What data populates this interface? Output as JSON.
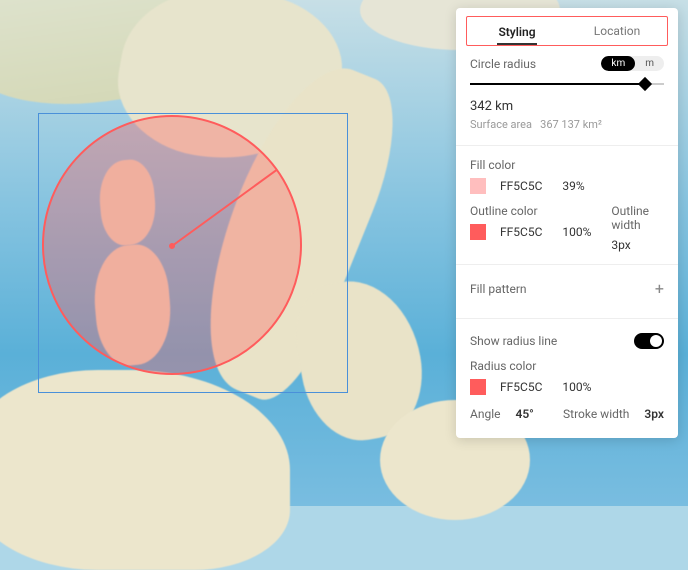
{
  "tabs": {
    "styling": "Styling",
    "location": "Location"
  },
  "radius": {
    "label": "Circle radius",
    "unit_km": "km",
    "unit_m": "m",
    "value": "342 km",
    "surface_label": "Surface area",
    "surface_value": "367 137 km²"
  },
  "fill": {
    "label": "Fill color",
    "hex": "FF5C5C",
    "opacity": "39%",
    "swatch": "#ff5c5c",
    "swatch_alpha": "rgba(255,92,92,0.4)"
  },
  "outline": {
    "color_label": "Outline color",
    "hex": "FF5C5C",
    "opacity": "100%",
    "width_label": "Outline width",
    "width_value": "3px",
    "swatch": "#ff5c5c"
  },
  "pattern": {
    "label": "Fill pattern"
  },
  "radiusline": {
    "show_label": "Show radius line",
    "color_label": "Radius color",
    "hex": "FF5C5C",
    "opacity": "100%",
    "angle_label": "Angle",
    "angle_value": "45°",
    "stroke_label": "Stroke width",
    "stroke_value": "3px",
    "swatch": "#ff5c5c"
  }
}
